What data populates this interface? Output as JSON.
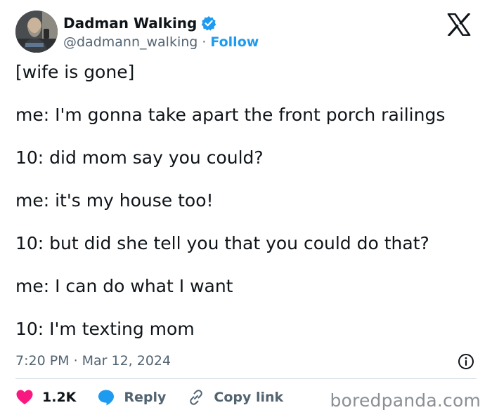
{
  "author": {
    "display_name": "Dadman Walking",
    "handle": "@dadmann_walking",
    "separator": "·",
    "follow_label": "Follow"
  },
  "tweet": {
    "lines": [
      "[wife is gone]",
      "me: I'm gonna take apart the front porch railings",
      "10: did mom say you could?",
      "me: it's my house too!",
      "10: but did she tell you that you could do that?",
      "me: I can do what I want",
      "10: I'm texting mom"
    ],
    "time": "7:20 PM",
    "date_separator": "·",
    "date": "Mar 12, 2024"
  },
  "actions": {
    "like_count": "1.2K",
    "reply_label": "Reply",
    "copy_link_label": "Copy link"
  },
  "icons": [
    "verified-badge-icon",
    "x-logo-icon",
    "info-icon",
    "heart-icon",
    "reply-bubble-icon",
    "link-icon"
  ],
  "colors": {
    "accent": "#1d9bf0",
    "heart": "#f91880",
    "text": "#0f1419",
    "secondary": "#536471",
    "divider": "#cfd9de",
    "watermark": "#8a8f94"
  },
  "watermark": "boredpanda.com"
}
